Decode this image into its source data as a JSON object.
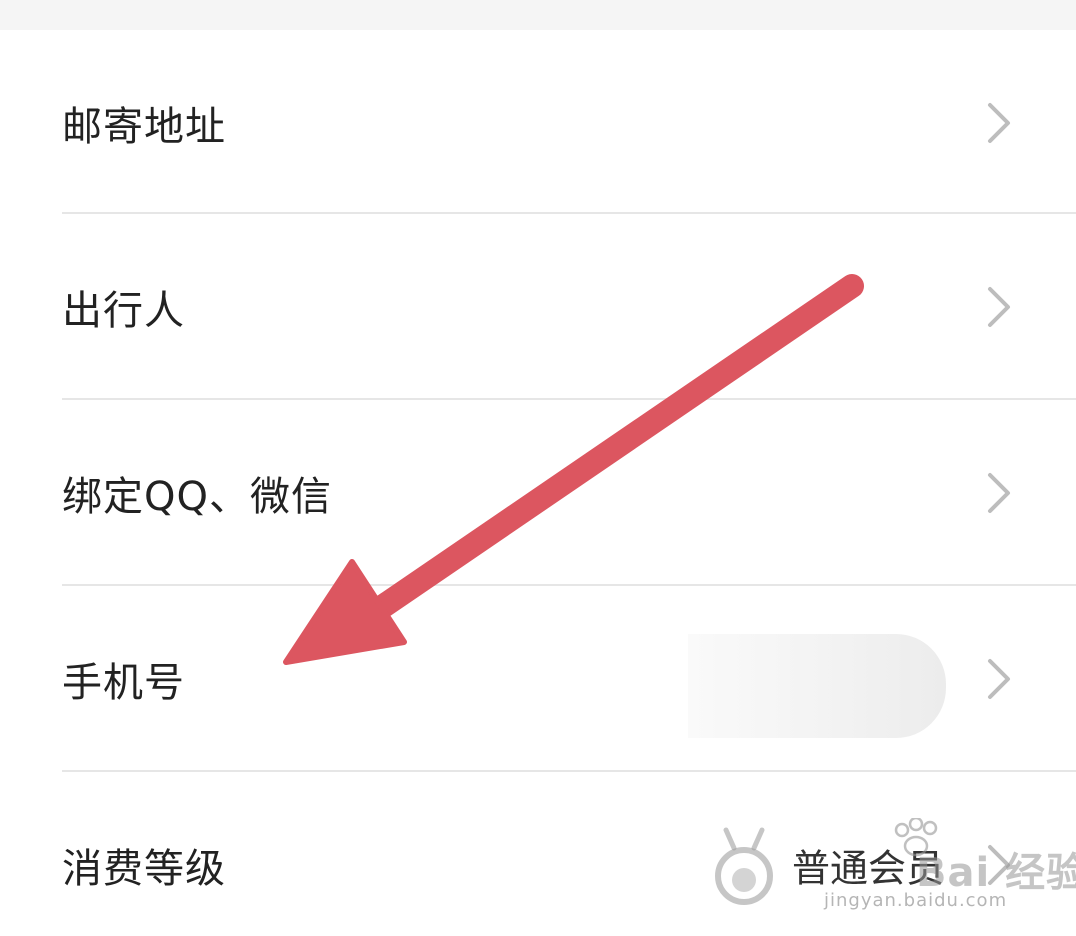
{
  "settings": {
    "rows": [
      {
        "label": "邮寄地址",
        "value": ""
      },
      {
        "label": "出行人",
        "value": ""
      },
      {
        "label": "绑定QQ、微信",
        "value": ""
      },
      {
        "label": "手机号",
        "value": ""
      },
      {
        "label": "消费等级",
        "value": "普通会员"
      }
    ]
  },
  "icons": {
    "chevron": "chevron-right-icon",
    "chevron_color": "#bdbdbd"
  },
  "annotation": {
    "arrow_color": "#dc5660"
  },
  "watermark": {
    "brand": "Bai 经验",
    "url": "jingyan.baidu.com"
  }
}
